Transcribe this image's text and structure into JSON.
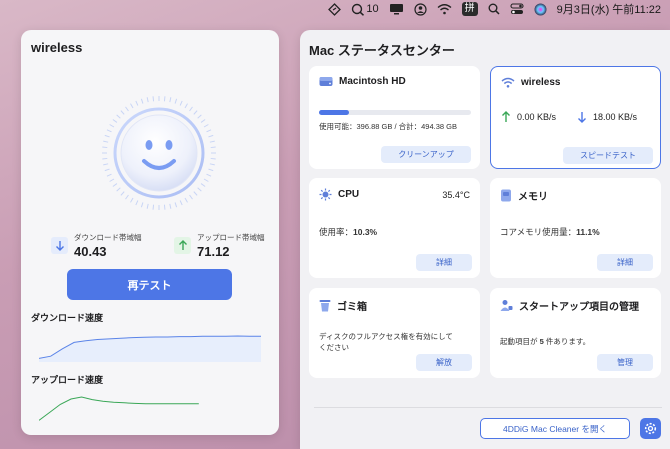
{
  "menubar": {
    "status_badge": "10",
    "ime_label": "拼",
    "clock": "9月3日(水) 午前11:22"
  },
  "left": {
    "title": "wireless",
    "download_label": "ダウンロード帯域幅",
    "download_value": "40.43",
    "upload_label": "アップロード帯域幅",
    "upload_value": "71.12",
    "retest_label": "再テスト",
    "download_speed_title": "ダウンロード速度",
    "upload_speed_title": "アップロード速度",
    "download_curve": [
      0.05,
      0.12,
      0.35,
      0.55,
      0.6,
      0.64,
      0.66,
      0.68,
      0.7,
      0.71,
      0.72,
      0.72,
      0.73,
      0.73,
      0.74,
      0.74,
      0.74,
      0.75,
      0.74,
      0.74
    ],
    "upload_curve": [
      0.05,
      0.3,
      0.55,
      0.72,
      0.78,
      0.7,
      0.65,
      0.62,
      0.6,
      0.58,
      0.57,
      0.57,
      0.57,
      0.57,
      0.57,
      0.57
    ]
  },
  "right": {
    "title": "Mac ステータスセンター",
    "disk": {
      "name": "Macintosh HD",
      "usage_text": "使用可能：396.88 GB / 合計：494.38 GB",
      "used_fraction": 0.2,
      "button": "クリーンアップ"
    },
    "network": {
      "name": "wireless",
      "upload_value": "0.00 KB/s",
      "download_value": "18.00 KB/s",
      "button": "スピードテスト"
    },
    "cpu": {
      "name": "CPU",
      "temperature": "35.4°C",
      "usage_label": "使用率：",
      "usage_value": "10.3%",
      "button": "詳細"
    },
    "memory": {
      "name": "メモリ",
      "usage_label": "コアメモリ使用量：",
      "usage_value": "11.1%",
      "button": "詳細"
    },
    "trash": {
      "name": "ゴミ箱",
      "text_line1": "ディスクのフルアクセス権を有効にして",
      "text_line2": "ください",
      "button": "解放"
    },
    "startup": {
      "name": "スタートアップ項目の管理",
      "text_prefix": "起動項目が ",
      "count": "5",
      "text_suffix": " 件あります。",
      "button": "管理"
    },
    "footer_button": "4DDiG Mac Cleaner を開く"
  },
  "colors": {
    "accent": "#4d76e6",
    "download_line": "#5b84e8",
    "upload_line": "#3aa757"
  }
}
